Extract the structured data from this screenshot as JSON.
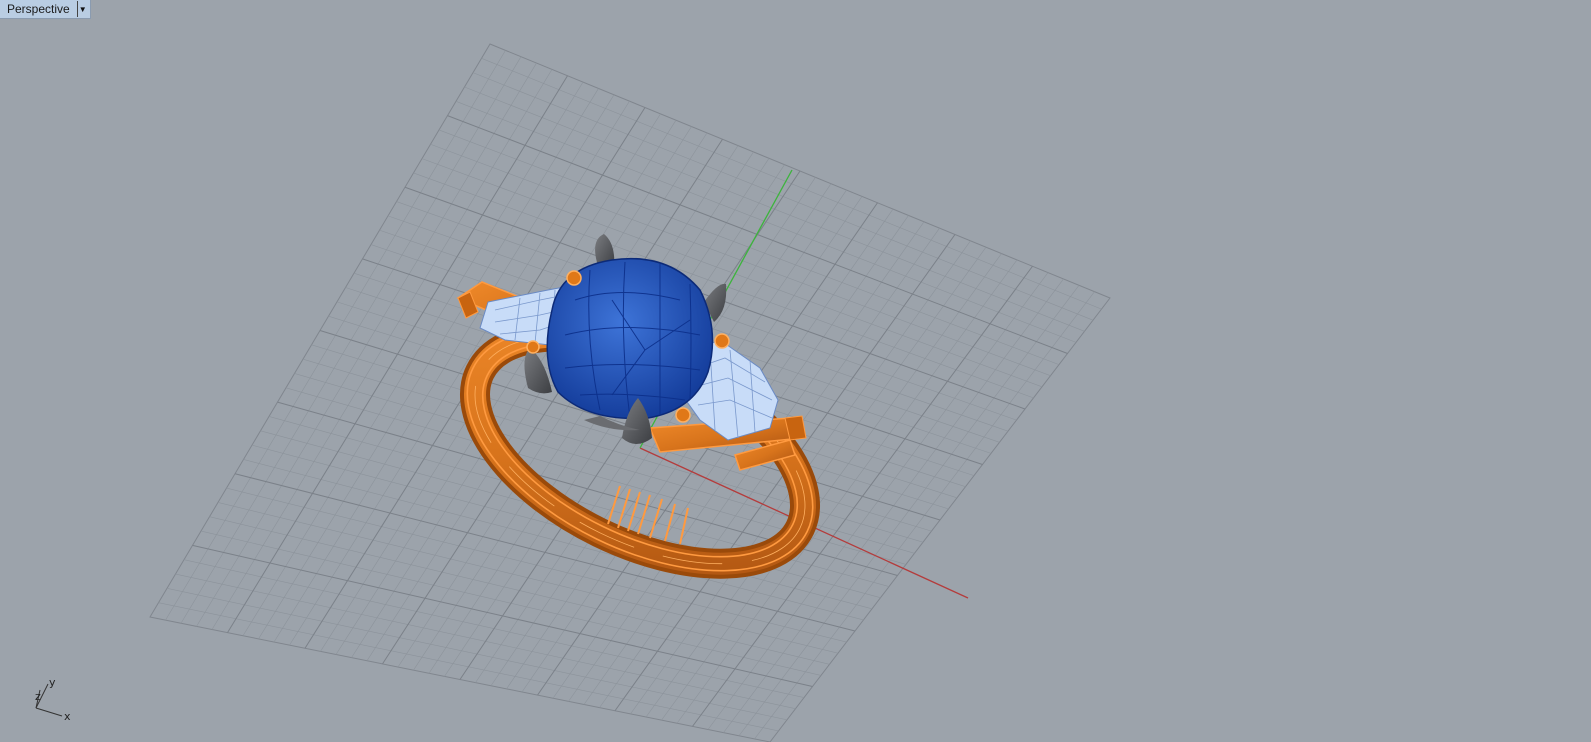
{
  "viewport": {
    "title": "Perspective",
    "menu_icon": "dropdown-arrow-icon",
    "colors": {
      "background": "#9ca3ab",
      "grid": "#8a9098",
      "x_axis": "#b43c3c",
      "y_axis": "#3cb43c",
      "metal": "#e07818",
      "center_gem": "#1a48b8",
      "side_gem": "#c8dcf8",
      "prongs": "#5a5c60"
    }
  },
  "axis_widget": {
    "x_label": "x",
    "y_label": "y",
    "z_label": "z"
  }
}
